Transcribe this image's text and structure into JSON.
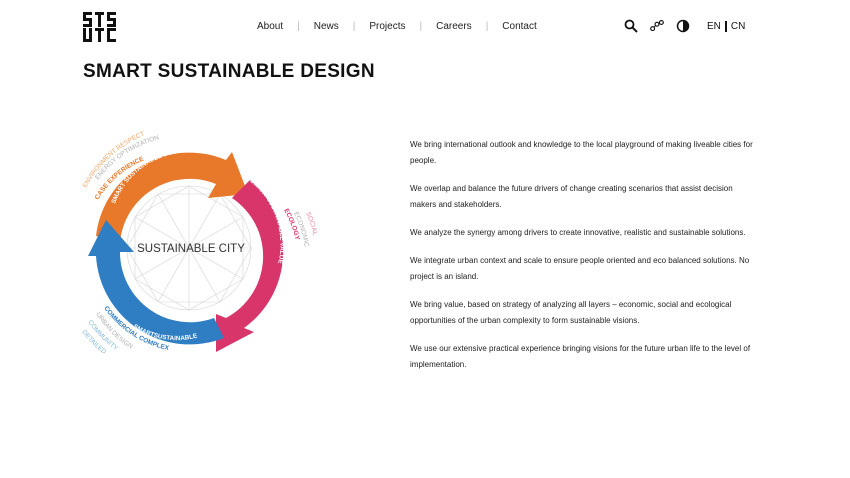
{
  "nav": {
    "items": [
      {
        "label": "About"
      },
      {
        "label": "News"
      },
      {
        "label": "Projects"
      },
      {
        "label": "Careers"
      },
      {
        "label": "Contact"
      }
    ]
  },
  "tools": {
    "icons": [
      "search-icon",
      "share-icon",
      "contrast-icon"
    ]
  },
  "lang": {
    "en": "EN",
    "cn": "CN"
  },
  "page": {
    "title": "SMART SUSTAINABLE DESIGN"
  },
  "diagram": {
    "center": "SUSTAINABLE CITY",
    "orange": {
      "arc": "SMART SUSTAINABLE DESIGN",
      "outer1": "CASE EXPERIENCE",
      "outer2": "ENERGY OPTIMIZATION",
      "outer3": "ENVIRONMENT RESPECT"
    },
    "pink": {
      "arc": "SMART SUSTAINABLE VALUE",
      "outer1": "ECOLOGY",
      "outer2": "ECONOMIC",
      "outer3": "SOCIAL"
    },
    "blue": {
      "arc": "SMARTSUSTAINABLE",
      "outer1": "COMMERCIAL COMPLEX",
      "outer2": "URBAN DESIGN",
      "outer3": "COMMUNITY",
      "outer4": "DETAILED"
    },
    "colors": {
      "orange": "#e8782a",
      "pink": "#d8356b",
      "blue": "#2f7ec4",
      "orange_light": "#f0a86e",
      "pink_light": "#e9899f",
      "blue_light": "#86b9df"
    }
  },
  "paragraphs": [
    "We bring international outlook and knowledge to the local playground of making liveable cities for people.",
    "We overlap and balance the future drivers of change creating scenarios that assist decision makers and stakeholders.",
    "We analyze the synergy among drivers to create innovative, realistic and sustainable solutions.",
    "We integrate urban context and scale to ensure people oriented and eco balanced solutions. No project is an island.",
    "We bring value, based on strategy of analyzing all layers – economic, social and ecological opportunities of the urban complexity to form sustainable visions.",
    "We use our extensive practical experience bringing visions for the future urban life to the level of implementation."
  ]
}
